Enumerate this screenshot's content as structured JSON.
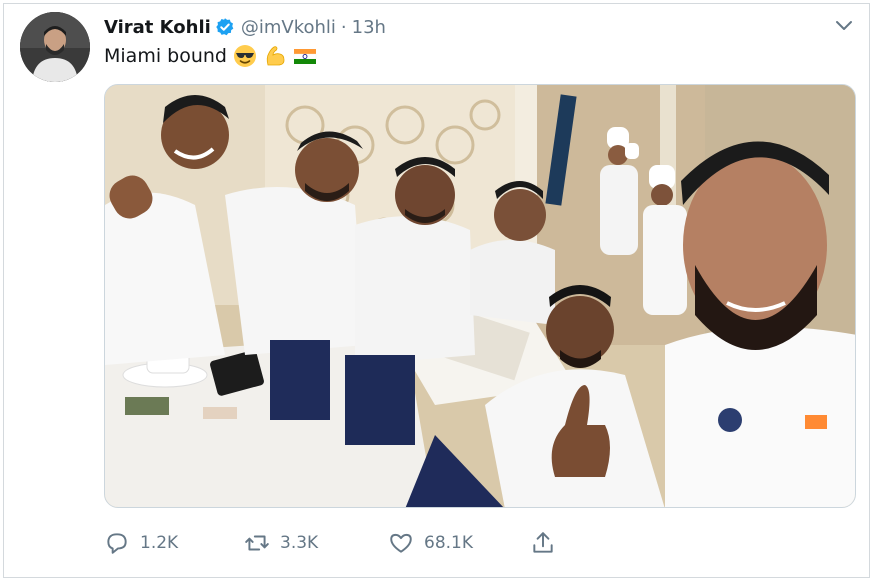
{
  "tweet": {
    "author_name": "Virat Kohli",
    "handle": "@imVkohli",
    "separator": "·",
    "time": "13h",
    "text": "Miami bound",
    "emojis": [
      "sunglasses-face-emoji",
      "flexed-biceps-emoji",
      "india-flag-emoji"
    ],
    "verified": true
  },
  "actions": {
    "reply_count": "1.2K",
    "retweet_count": "3.3K",
    "like_count": "68.1K"
  },
  "colors": {
    "verified_blue": "#1da1f2",
    "muted_text": "#657786",
    "primary_text": "#14171a",
    "border": "#d4d9dd"
  },
  "icons": [
    "verified-badge-icon",
    "chevron-down-icon",
    "reply-icon",
    "retweet-icon",
    "like-icon",
    "share-icon"
  ]
}
